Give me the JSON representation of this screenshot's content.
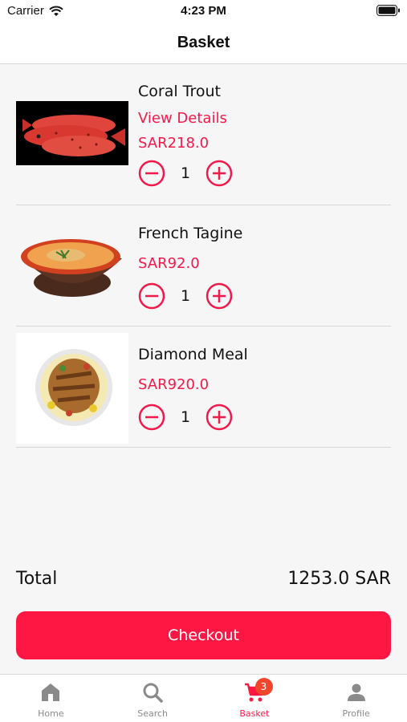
{
  "status": {
    "carrier": "Carrier",
    "time": "4:23 PM"
  },
  "nav": {
    "title": "Basket"
  },
  "items": [
    {
      "name": "Coral Trout",
      "details": "View Details",
      "price": "SAR218.0",
      "qty": "1"
    },
    {
      "name": "French Tagine",
      "price": "SAR92.0",
      "qty": "1"
    },
    {
      "name": "Diamond Meal",
      "price": "SAR920.0",
      "qty": "1"
    }
  ],
  "total": {
    "label": "Total",
    "value": "1253.0 SAR"
  },
  "checkout": {
    "label": "Checkout"
  },
  "tabs": [
    {
      "label": "Home",
      "icon": "home-icon"
    },
    {
      "label": "Search",
      "icon": "search-icon"
    },
    {
      "label": "Basket",
      "icon": "cart-icon",
      "badge": "3",
      "active": true
    },
    {
      "label": "Profile",
      "icon": "person-icon"
    }
  ],
  "colors": {
    "accent": "#ff1744",
    "badge": "#f1462b"
  }
}
